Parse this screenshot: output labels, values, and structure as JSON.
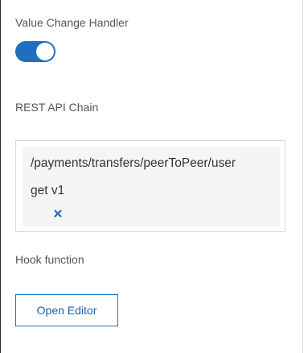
{
  "value_change_handler": {
    "label": "Value Change Handler",
    "enabled": true,
    "accent_color": "#1f6fbf"
  },
  "rest_api_chain": {
    "label": "REST API Chain",
    "items": [
      {
        "path": "/payments/transfers/peerToPeer/user",
        "method": "get v1",
        "remove_icon": "close-icon",
        "remove_icon_color": "#1f6fbf"
      }
    ]
  },
  "hook_function": {
    "label": "Hook function",
    "button_label": "Open Editor"
  }
}
